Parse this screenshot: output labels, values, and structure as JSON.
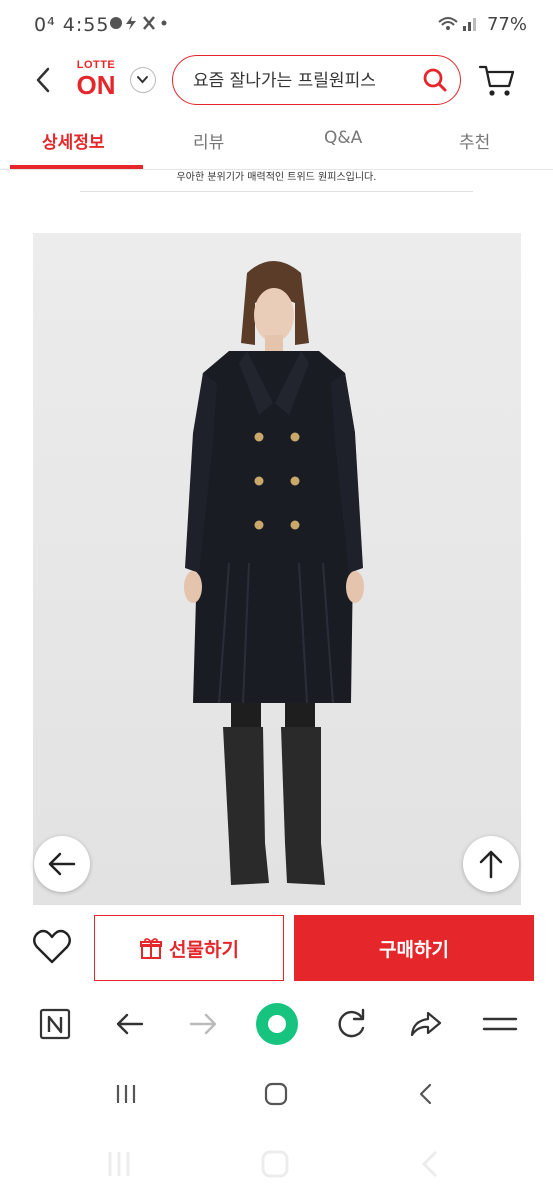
{
  "status": {
    "time": "0⁴ 4:55",
    "battery": "77%"
  },
  "header": {
    "logo_top": "LOTTE",
    "logo_bottom": "ON",
    "search_placeholder": "요즘 잘나가는 프릴원피스"
  },
  "tabs": [
    {
      "label": "상세정보",
      "active": true
    },
    {
      "label": "리뷰",
      "active": false
    },
    {
      "label": "Q&A",
      "active": false
    },
    {
      "label": "추천",
      "active": false
    }
  ],
  "description": "우아한 분위기가 매력적인 트위드 원피스입니다.",
  "actions": {
    "gift_label": "선물하기",
    "buy_label": "구매하기"
  },
  "colors": {
    "accent": "#e5272b",
    "browser_home": "#16c47f"
  },
  "icons": {
    "back": "chevron-left-icon",
    "dropdown": "chevron-down-icon",
    "search": "search-icon",
    "cart": "cart-icon",
    "gift": "gift-icon",
    "heart": "heart-icon",
    "naver": "naver-n-icon",
    "refresh": "refresh-icon",
    "share": "share-icon",
    "menu": "menu-icon"
  }
}
